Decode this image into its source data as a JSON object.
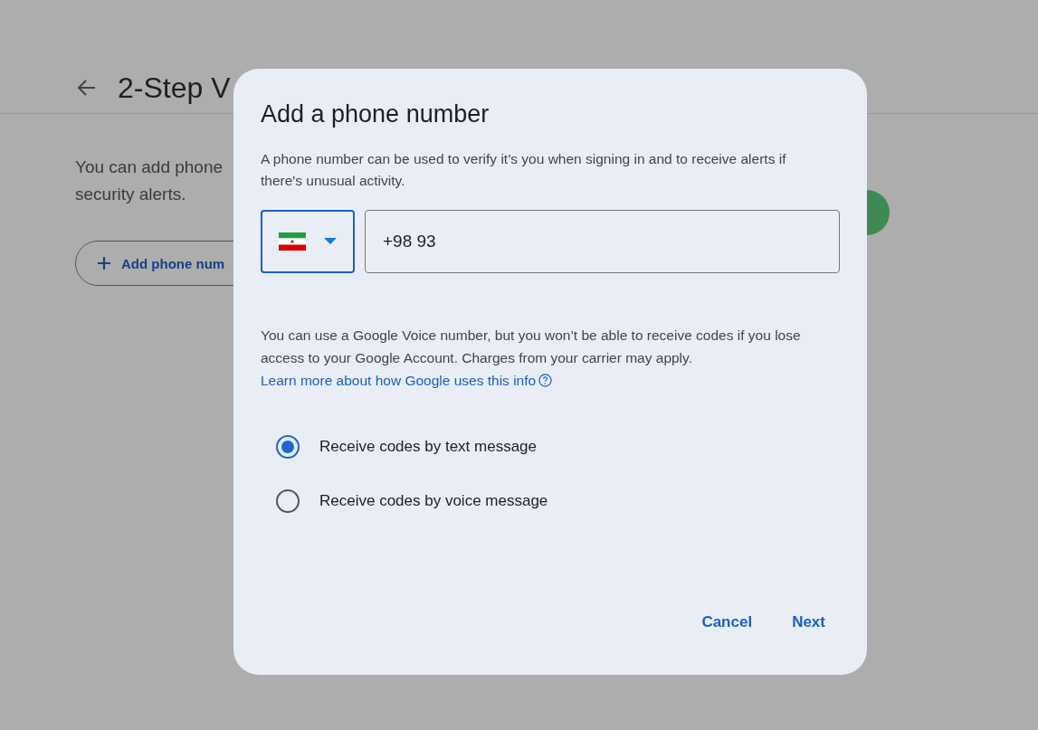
{
  "page": {
    "title": "2-Step V",
    "description_lines": [
      "You can add phone",
      "security alerts."
    ],
    "add_button": {
      "label": "Add phone num"
    }
  },
  "dialog": {
    "title": "Add a phone number",
    "description": "A phone number can be used to verify it’s you when signing in and to receive alerts if there's unusual activity.",
    "country_select": {
      "focused": true
    },
    "phone": {
      "value": "+98 93"
    },
    "note": "You can use a Google Voice number, but you won’t be able to receive codes if you lose access to your Google Account. Charges from your carrier may apply.",
    "link": "Learn more about how Google uses this info",
    "options": [
      {
        "label": "Receive codes by text message",
        "selected": true
      },
      {
        "label": "Receive codes by voice message",
        "selected": false
      }
    ],
    "buttons": [
      {
        "label": "Cancel"
      },
      {
        "label": "Next"
      }
    ]
  }
}
